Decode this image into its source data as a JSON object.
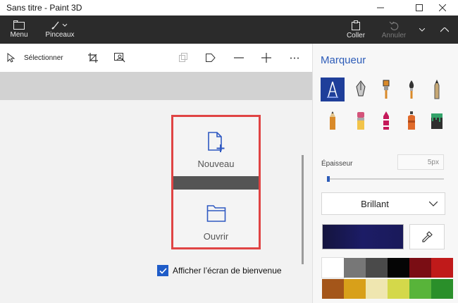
{
  "window": {
    "title": "Sans titre - Paint 3D"
  },
  "toolbar": {
    "menu_label": "Menu",
    "brushes_label": "Pinceaux",
    "paste_label": "Coller",
    "undo_label": "Annuler"
  },
  "secondary": {
    "select_label": "Sélectionner"
  },
  "panel": {
    "title": "Marqueur",
    "thickness_label": "Épaisseur",
    "thickness_value": "5px",
    "finish_value": "Brillant",
    "current_color": "#1c1c66",
    "brushes": [
      "marker",
      "calligraphy-pen",
      "oil-brush",
      "watercolor",
      "pixel-pen",
      "pencil",
      "eraser",
      "crayon",
      "spray-can",
      "fill-bucket"
    ],
    "palette": [
      "#ffffff",
      "#777777",
      "#4a4a4a",
      "#050505",
      "#7a0d14",
      "#c01a1a",
      "#a4561a",
      "#d8a01a",
      "#efe6b0",
      "#d4d84a",
      "#58b43a",
      "#2a8f2a"
    ]
  },
  "welcome": {
    "new_label": "Nouveau",
    "open_label": "Ouvrir",
    "show_welcome_label": "Afficher l’écran de bienvenue",
    "show_welcome_checked": true
  }
}
